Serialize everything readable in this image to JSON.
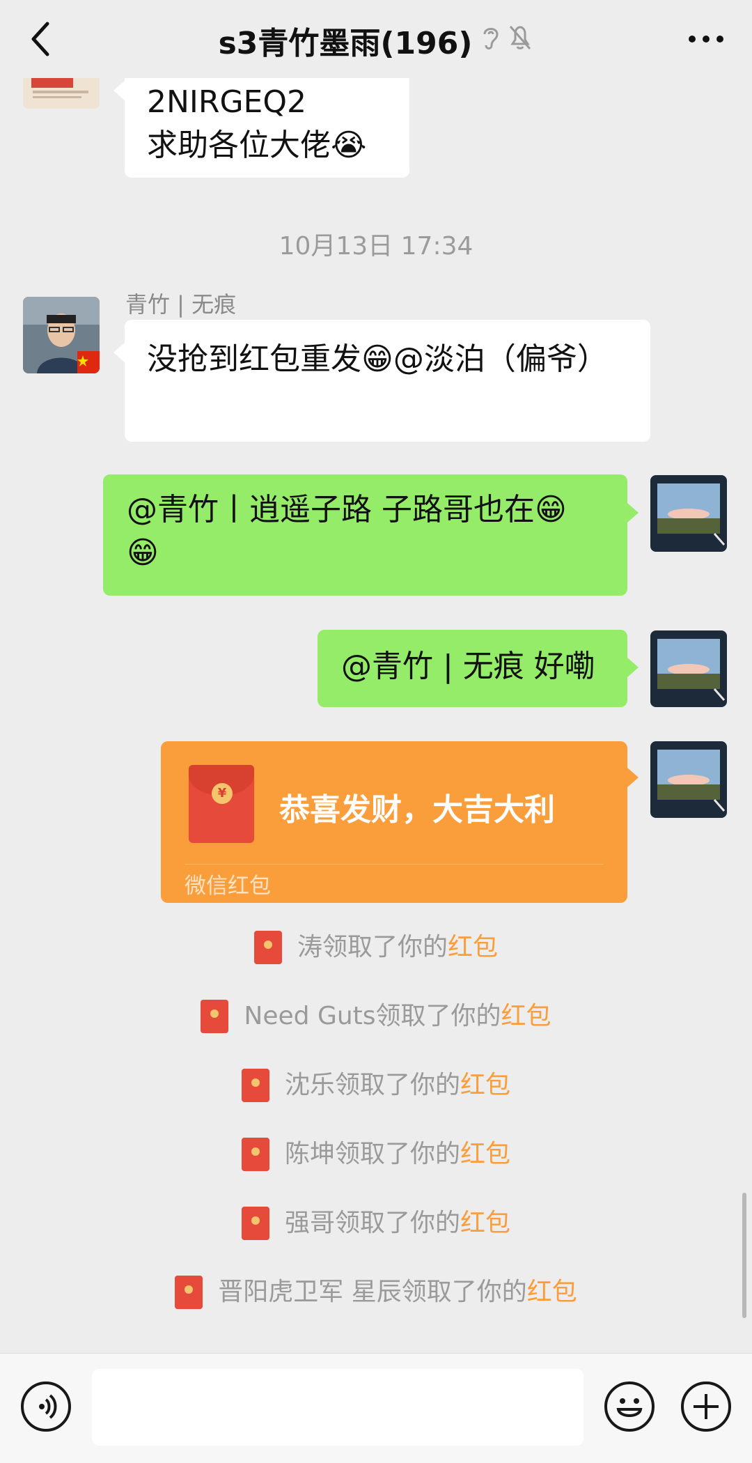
{
  "header": {
    "title": "s3青竹墨雨(196)",
    "icons": [
      "ear-icon",
      "mute-bell-icon"
    ]
  },
  "messages": {
    "m1": {
      "lines": [
        "2NIRGEQ2",
        "求助各位大佬😭"
      ]
    },
    "timestamp": "10月13日 17:34",
    "m2": {
      "sender": "青竹 | 无痕",
      "text": "没抢到红包重发😁@淡泊（偏爷）"
    },
    "m3": {
      "line1": "@青竹丨逍遥子路 子路哥也在😁",
      "line2": "😁"
    },
    "m4": {
      "text": "@青竹 | 无痕 好嘞"
    },
    "redpacket": {
      "title": "恭喜发财，大吉大利",
      "footer": "微信红包"
    }
  },
  "notices": [
    {
      "name": "涛",
      "action": "领取了你的",
      "highlight": "红包"
    },
    {
      "name": "Need Guts",
      "action": "领取了你的",
      "highlight": "红包"
    },
    {
      "name": "沈乐",
      "action": "领取了你的",
      "highlight": "红包"
    },
    {
      "name": "陈坤",
      "action": "领取了你的",
      "highlight": "红包"
    },
    {
      "name": "强哥",
      "action": "领取了你的",
      "highlight": "红包"
    },
    {
      "name": "晋阳虎卫军 星辰",
      "action": "领取了你的",
      "highlight": "红包"
    }
  ],
  "colors": {
    "background": "#ededed",
    "green_bubble": "#95ec69",
    "red_packet": "#fa9d3b",
    "highlight": "#fa9d3b"
  }
}
